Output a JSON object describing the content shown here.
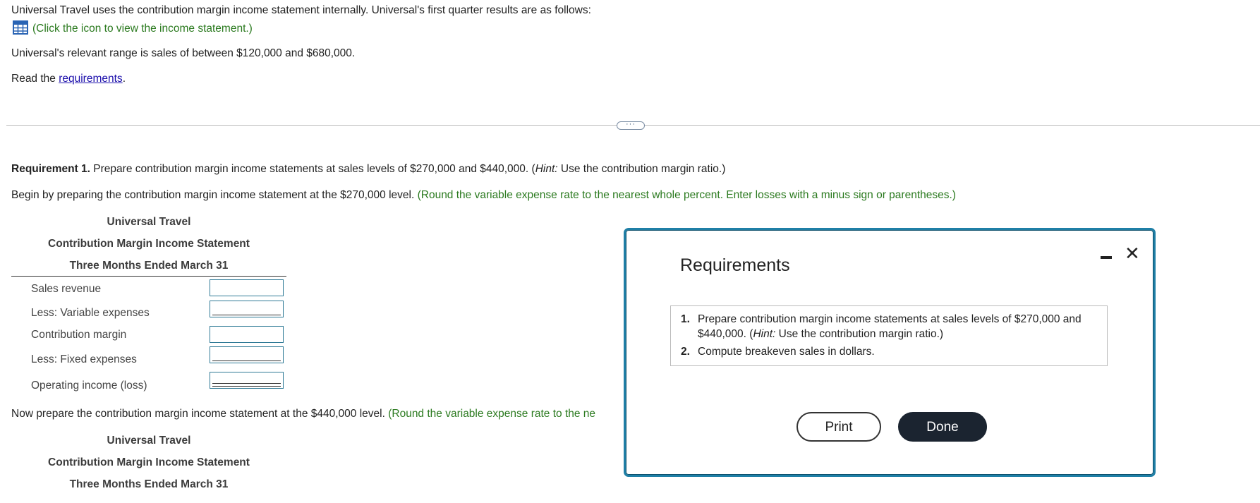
{
  "intro": {
    "line1": "Universal Travel uses the contribution margin income statement internally. Universal's first quarter results are as follows:",
    "icon_link": "(Click the icon to view the income statement.)",
    "range": "Universal's relevant range is sales of between $120,000 and $680,000.",
    "read_prefix": "Read the ",
    "read_link": "requirements",
    "read_suffix": "."
  },
  "divider": {
    "handle": "···"
  },
  "req1": {
    "bold": "Requirement 1.",
    "text_a": " Prepare contribution margin income statements at sales levels of $270,000 and $440,000. (",
    "hint_word": "Hint:",
    "text_b": " Use the contribution margin ratio.)",
    "begin": "Begin by preparing the contribution margin income statement at the $270,000 level.",
    "begin_hint": "(Round the variable expense rate to the nearest whole percent. Enter losses with a minus sign or parentheses.)"
  },
  "statement1": {
    "company": "Universal Travel",
    "title": "Contribution Margin Income Statement",
    "period": "Three Months Ended March 31",
    "rows": [
      {
        "label": "Sales revenue",
        "value": ""
      },
      {
        "label": "Less: Variable expenses",
        "value": ""
      },
      {
        "label": "Contribution margin",
        "value": ""
      },
      {
        "label": "Less: Fixed expenses",
        "value": ""
      },
      {
        "label": "Operating income (loss)",
        "value": ""
      }
    ]
  },
  "next": {
    "text": "Now prepare the contribution margin income statement at the $440,000 level.",
    "hint": "(Round the variable expense rate to the ne"
  },
  "statement2": {
    "company": "Universal Travel",
    "title": "Contribution Margin Income Statement",
    "period": "Three Months Ended March 31"
  },
  "modal": {
    "title": "Requirements",
    "items": [
      {
        "num": "1.",
        "line1_a": "Prepare contribution margin income statements at sales levels of $270,000 and",
        "line2_a": "$440,000. (",
        "hint": "Hint:",
        "line2_b": " Use the contribution margin ratio.)"
      },
      {
        "num": "2.",
        "text": "Compute breakeven sales in dollars."
      }
    ],
    "print_label": "Print",
    "done_label": "Done",
    "close_glyph": "✕"
  }
}
